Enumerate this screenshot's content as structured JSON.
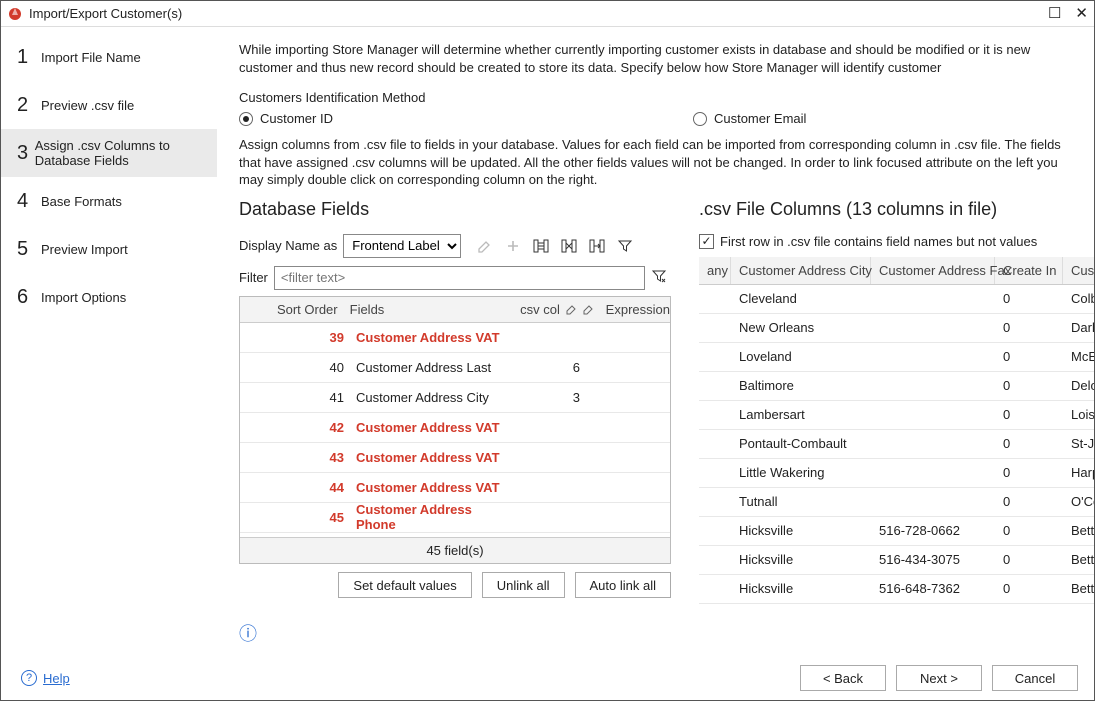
{
  "window": {
    "title": "Import/Export Customer(s)",
    "maximize_glyph": "☐",
    "close_glyph": "✕"
  },
  "sidebar": {
    "steps": [
      {
        "num": "1",
        "label": "Import File Name"
      },
      {
        "num": "2",
        "label": "Preview .csv file"
      },
      {
        "num": "3",
        "label": "Assign .csv Columns to Database Fields"
      },
      {
        "num": "4",
        "label": "Base Formats"
      },
      {
        "num": "5",
        "label": "Preview Import"
      },
      {
        "num": "6",
        "label": "Import Options"
      }
    ],
    "active_index": 2
  },
  "main": {
    "instr1": "While importing Store Manager will determine whether currently importing customer exists in database and should be modified or it is new customer and thus new record should be created to store its data. Specify below how Store Manager will identify customer",
    "id_method_label": "Customers Identification Method",
    "radio_id": "Customer  ID",
    "radio_email": "Customer Email",
    "instr2": "Assign columns from .csv file to fields in your database. Values for each field can be imported from corresponding column in .csv file. The fields that have assigned .csv columns will be updated. All the other fields values will not be changed. In order to link focused attribute on the left you may simply double click on corresponding column on the right."
  },
  "left": {
    "heading": "Database Fields",
    "display_label": "Display Name as",
    "display_value": "Frontend Label",
    "filter_label": "Filter",
    "filter_placeholder": "<filter text>",
    "headers": {
      "sort": "Sort Order",
      "fields": "Fields",
      "csv": "csv col",
      "expr": "Expression"
    },
    "rows": [
      {
        "sort": "39",
        "field": "Customer Address VAT",
        "csv": "",
        "hl": true
      },
      {
        "sort": "40",
        "field": "Customer Address Last",
        "csv": "6",
        "hl": false
      },
      {
        "sort": "41",
        "field": "Customer Address City",
        "csv": "3",
        "hl": false
      },
      {
        "sort": "42",
        "field": "Customer Address VAT",
        "csv": "",
        "hl": true
      },
      {
        "sort": "43",
        "field": "Customer Address VAT",
        "csv": "",
        "hl": true
      },
      {
        "sort": "44",
        "field": "Customer Address VAT",
        "csv": "",
        "hl": true
      },
      {
        "sort": "45",
        "field": "Customer Address Phone",
        "csv": "",
        "hl": true
      }
    ],
    "footer": "45 field(s)",
    "buttons": {
      "defaults": "Set default values",
      "unlink": "Unlink all",
      "autolink": "Auto link all"
    }
  },
  "right": {
    "heading": ".csv File Columns (13 columns in file)",
    "first_row_label": "First row in .csv file contains field names but not values",
    "first_row_checked": true,
    "headers": {
      "any": "any",
      "city": "Customer Address City",
      "fax": "Customer Address Fax",
      "create": "Create In",
      "cust": "Custom"
    },
    "rows": [
      {
        "city": "Cleveland",
        "fax": "",
        "create": "0",
        "cust": "Colburn"
      },
      {
        "city": "New Orleans",
        "fax": "",
        "create": "0",
        "cust": "Darling"
      },
      {
        "city": "Loveland",
        "fax": "",
        "create": "0",
        "cust": "McEvoy"
      },
      {
        "city": "Baltimore",
        "fax": "",
        "create": "0",
        "cust": "Delossa"
      },
      {
        "city": "Lambersart",
        "fax": "",
        "create": "0",
        "cust": "Loiselle"
      },
      {
        "city": "Pontault-Combault",
        "fax": "",
        "create": "0",
        "cust": "St-Jean"
      },
      {
        "city": "Little Wakering",
        "fax": "",
        "create": "0",
        "cust": "Harper"
      },
      {
        "city": "Tutnall",
        "fax": "",
        "create": "0",
        "cust": "O'Conn"
      },
      {
        "city": "Hicksville",
        "fax": "516-728-0662",
        "create": "0",
        "cust": "Betts"
      },
      {
        "city": "Hicksville",
        "fax": "516-434-3075",
        "create": "0",
        "cust": "Betts"
      },
      {
        "city": "Hicksville",
        "fax": "516-648-7362",
        "create": "0",
        "cust": "Betts"
      }
    ]
  },
  "footer": {
    "help": "Help",
    "back": "< Back",
    "next": "Next >",
    "cancel": "Cancel"
  }
}
